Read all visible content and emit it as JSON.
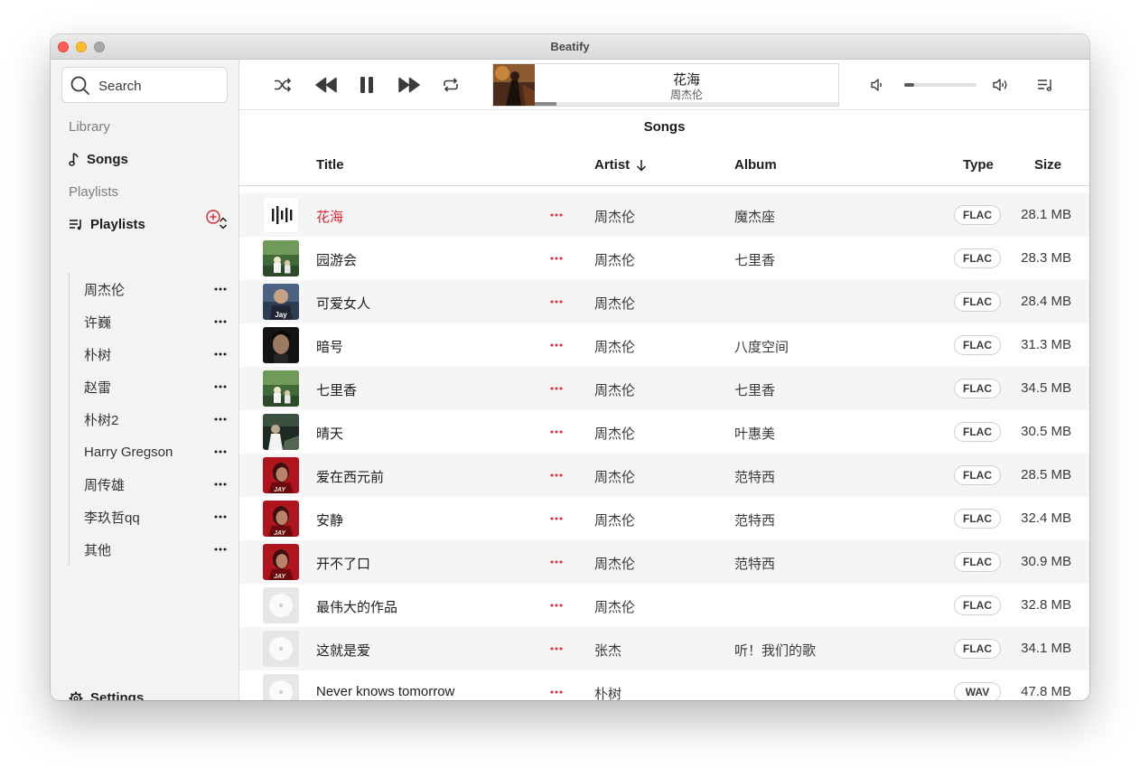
{
  "window": {
    "title": "Beatify"
  },
  "sidebar": {
    "search_placeholder": "Search",
    "library_label": "Library",
    "songs_label": "Songs",
    "playlists_section_label": "Playlists",
    "playlists_group_label": "Playlists",
    "playlists": [
      "周杰伦",
      "许巍",
      "朴树",
      "赵雷",
      "朴树2",
      "Harry Gregson",
      "周传雄",
      "李玖哲qq",
      "其他"
    ],
    "settings_label": "Settings"
  },
  "player": {
    "now_playing_title": "花海",
    "now_playing_artist": "周杰伦",
    "progress": 0.07,
    "volume": 0.14,
    "state": "playing"
  },
  "songs_view": {
    "title": "Songs",
    "columns": {
      "title": "Title",
      "artist": "Artist",
      "album": "Album",
      "type": "Type",
      "size": "Size"
    },
    "sort_column": "Artist",
    "sort_direction": "descending"
  },
  "songs": [
    {
      "title": "花海",
      "artist": "周杰伦",
      "album": "魔杰座",
      "type": "FLAC",
      "size": "28.1 MB",
      "cover": "playing-bars",
      "playing": true
    },
    {
      "title": "园游会",
      "artist": "周杰伦",
      "album": "七里香",
      "type": "FLAC",
      "size": "28.3 MB",
      "cover": "qilixiang"
    },
    {
      "title": "可爱女人",
      "artist": "周杰伦",
      "album": "",
      "type": "FLAC",
      "size": "28.4 MB",
      "cover": "jay"
    },
    {
      "title": "暗号",
      "artist": "周杰伦",
      "album": "八度空间",
      "type": "FLAC",
      "size": "31.3 MB",
      "cover": "badu"
    },
    {
      "title": "七里香",
      "artist": "周杰伦",
      "album": "七里香",
      "type": "FLAC",
      "size": "34.5 MB",
      "cover": "qilixiang"
    },
    {
      "title": "晴天",
      "artist": "周杰伦",
      "album": "叶惠美",
      "type": "FLAC",
      "size": "30.5 MB",
      "cover": "yehuimei"
    },
    {
      "title": "爱在西元前",
      "artist": "周杰伦",
      "album": "范特西",
      "type": "FLAC",
      "size": "28.5 MB",
      "cover": "fantexi"
    },
    {
      "title": "安静",
      "artist": "周杰伦",
      "album": "范特西",
      "type": "FLAC",
      "size": "32.4 MB",
      "cover": "fantexi"
    },
    {
      "title": "开不了口",
      "artist": "周杰伦",
      "album": "范特西",
      "type": "FLAC",
      "size": "30.9 MB",
      "cover": "fantexi"
    },
    {
      "title": "最伟大的作品",
      "artist": "周杰伦",
      "album": "",
      "type": "FLAC",
      "size": "32.8 MB",
      "cover": "placeholder-disc"
    },
    {
      "title": "这就是爱",
      "artist": "张杰",
      "album": "听！我们的歌",
      "type": "FLAC",
      "size": "34.1 MB",
      "cover": "placeholder-disc"
    },
    {
      "title": "Never knows tomorrow",
      "artist": "朴树",
      "album": "",
      "type": "WAV",
      "size": "47.8 MB",
      "cover": "placeholder-disc"
    }
  ],
  "colors": {
    "accent": "#e0262f",
    "sidebar_bg": "#f3f3f3",
    "row_alt": "#f5f5f5"
  }
}
